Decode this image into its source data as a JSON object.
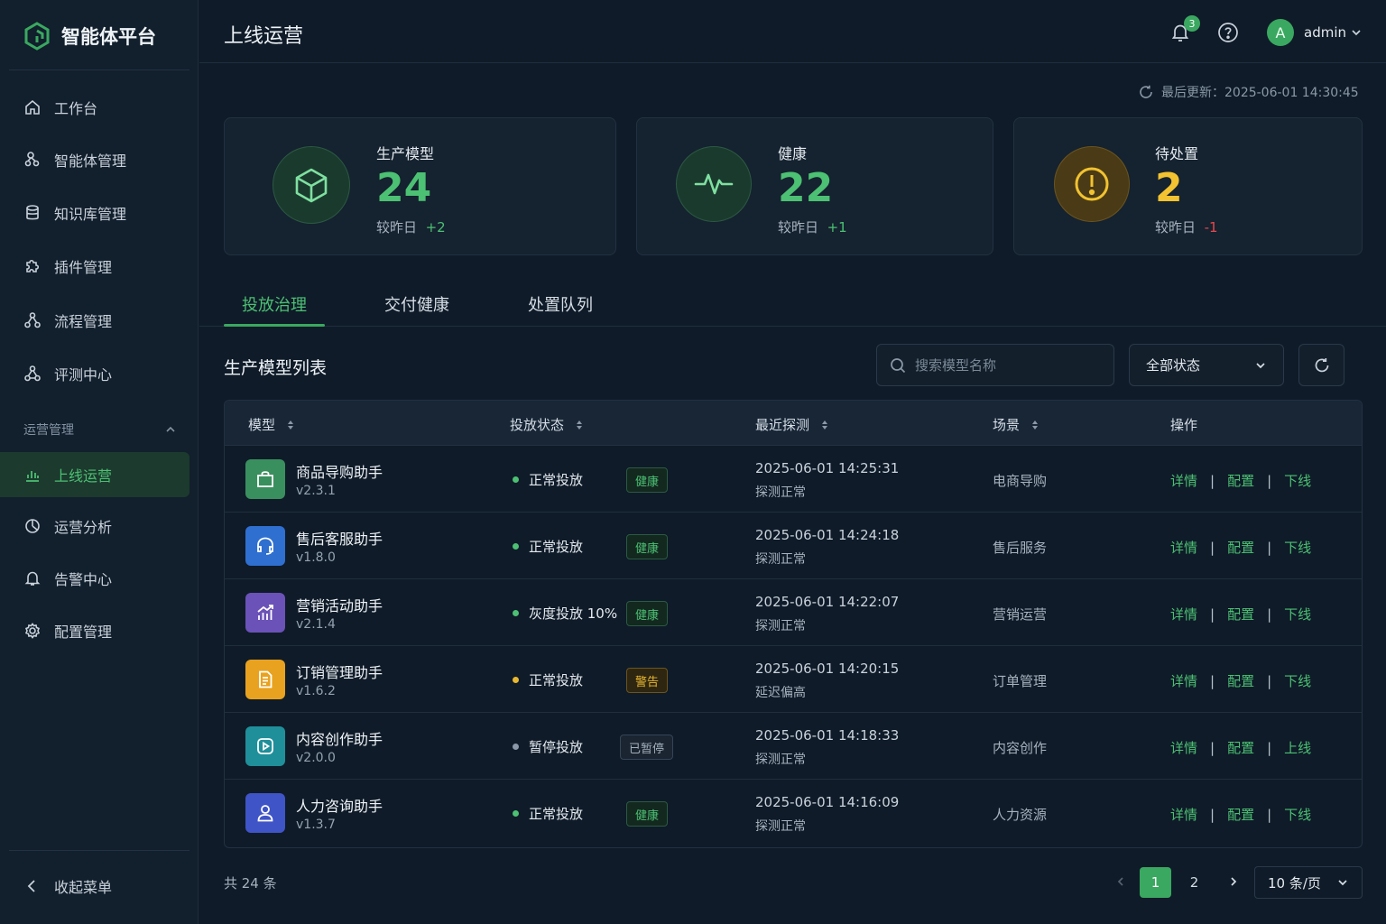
{
  "brand": {
    "name": "智能体平台",
    "accent": "#3aa860"
  },
  "sidebar": {
    "items": [
      {
        "label": "工作台",
        "icon": "home-icon"
      },
      {
        "label": "智能体管理",
        "icon": "agent-icon"
      },
      {
        "label": "知识库管理",
        "icon": "database-icon"
      },
      {
        "label": "插件管理",
        "icon": "puzzle-icon"
      },
      {
        "label": "流程管理",
        "icon": "flow-icon"
      },
      {
        "label": "评测中心",
        "icon": "eval-icon"
      }
    ],
    "group_title": "运营管理",
    "group_items": [
      {
        "label": "上线运营",
        "icon": "bar-chart-icon",
        "active": true
      },
      {
        "label": "运营分析",
        "icon": "pie-icon"
      },
      {
        "label": "告警中心",
        "icon": "bell-icon"
      },
      {
        "label": "配置管理",
        "icon": "gear-icon"
      }
    ],
    "collapse_label": "收起菜单"
  },
  "header": {
    "title": "上线运营",
    "notification_count": "3",
    "user_initial": "A",
    "user_name": "admin"
  },
  "last_updated": "最后更新：2025-06-01 14:30:45",
  "stats": [
    {
      "label": "生产模型",
      "value": "24",
      "delta_label": "较昨日",
      "delta": "+2",
      "color": "#4cc073"
    },
    {
      "label": "健康",
      "value": "22",
      "delta_label": "较昨日",
      "delta": "+1",
      "color": "#4cc073"
    },
    {
      "label": "待处置",
      "value": "2",
      "delta_label": "较昨日",
      "delta": "-1",
      "color": "#f2c230",
      "delta_color": "#e5484d"
    }
  ],
  "tabs": [
    {
      "label": "投放治理",
      "active": true
    },
    {
      "label": "交付健康"
    },
    {
      "label": "处置队列"
    }
  ],
  "list": {
    "title": "生产模型列表",
    "search_placeholder": "搜索模型名称",
    "filter_value": "全部状态",
    "columns": [
      "模型",
      "投放状态",
      "最近探测",
      "场景",
      "操作"
    ],
    "rows": [
      {
        "name": "商品导购助手",
        "version": "v2.3.1",
        "icon": "shopping-bag-icon",
        "icon_color": "#3a8f5e",
        "status": "正常投放",
        "status_color": "#4cc073",
        "tag": "健康",
        "tag_type": "ok",
        "probe_time": "2025-06-01 14:25:31",
        "probe_status": "探测正常",
        "scene": "电商导购",
        "actions": [
          "详情",
          "配置",
          "下线"
        ]
      },
      {
        "name": "售后客服助手",
        "version": "v1.8.0",
        "icon": "headset-icon",
        "icon_color": "#2f6fd0",
        "status": "正常投放",
        "status_color": "#4cc073",
        "tag": "健康",
        "tag_type": "ok",
        "probe_time": "2025-06-01 14:24:18",
        "probe_status": "探测正常",
        "scene": "售后服务",
        "actions": [
          "详情",
          "配置",
          "下线"
        ]
      },
      {
        "name": "营销活动助手",
        "version": "v2.1.4",
        "icon": "growth-chart-icon",
        "icon_color": "#6b52b8",
        "status": "灰度投放 10%",
        "status_color": "#4cc073",
        "tag": "健康",
        "tag_type": "ok",
        "probe_time": "2025-06-01 14:22:07",
        "probe_status": "探测正常",
        "scene": "营销运营",
        "actions": [
          "详情",
          "配置",
          "下线"
        ]
      },
      {
        "name": "订销管理助手",
        "version": "v1.6.2",
        "icon": "document-icon",
        "icon_color": "#e8a21f",
        "status": "正常投放",
        "status_color": "#e8b730",
        "tag": "警告",
        "tag_type": "warn",
        "probe_time": "2025-06-01 14:20:15",
        "probe_status": "延迟偏高",
        "scene": "订单管理",
        "actions": [
          "详情",
          "配置",
          "下线"
        ]
      },
      {
        "name": "内容创作助手",
        "version": "v2.0.0",
        "icon": "play-icon",
        "icon_color": "#1f8f9a",
        "status": "暂停投放",
        "status_color": "#8a98a7",
        "tag": "已暂停",
        "tag_type": "pause",
        "probe_time": "2025-06-01 14:18:33",
        "probe_status": "探测正常",
        "scene": "内容创作",
        "actions": [
          "详情",
          "配置",
          "上线"
        ]
      },
      {
        "name": "人力咨询助手",
        "version": "v1.3.7",
        "icon": "user-icon",
        "icon_color": "#3f54c7",
        "status": "正常投放",
        "status_color": "#4cc073",
        "tag": "健康",
        "tag_type": "ok",
        "probe_time": "2025-06-01 14:16:09",
        "probe_status": "探测正常",
        "scene": "人力资源",
        "actions": [
          "详情",
          "配置",
          "下线"
        ]
      }
    ]
  },
  "pagination": {
    "total": "共 24 条",
    "pages": [
      "1",
      "2"
    ],
    "current": "1",
    "page_size": "10 条/页"
  }
}
